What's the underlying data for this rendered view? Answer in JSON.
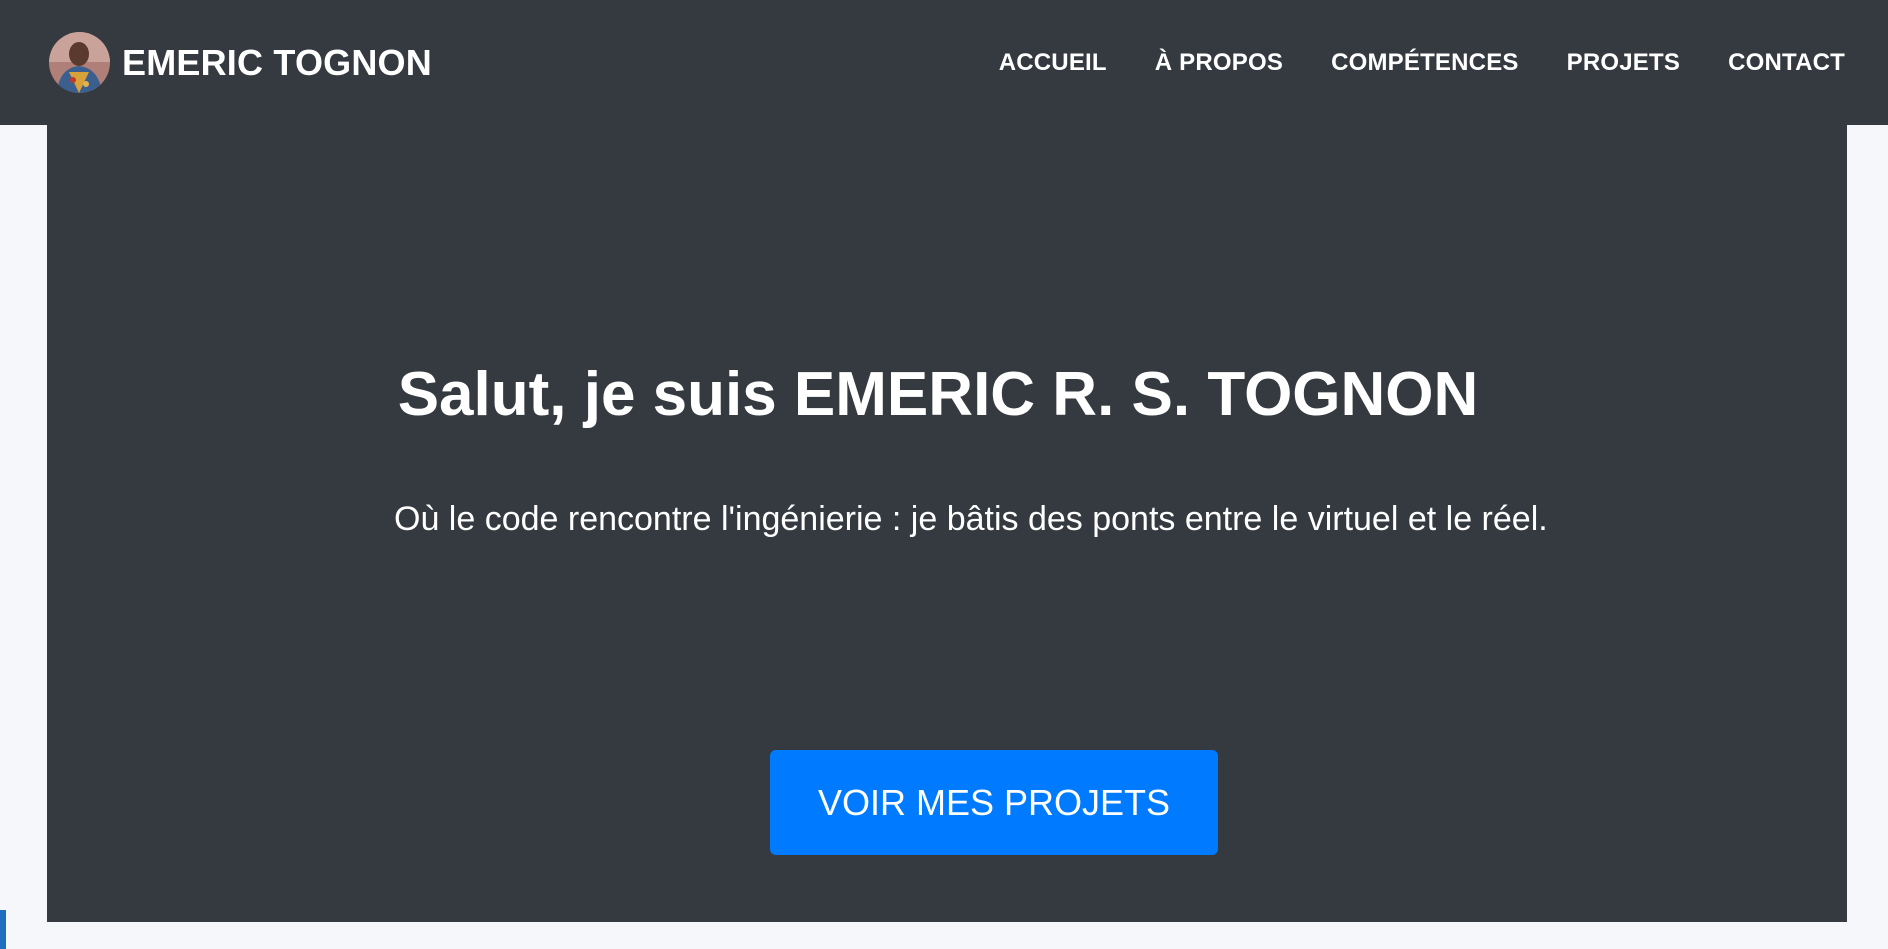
{
  "navbar": {
    "brand_name": "EMERIC TOGNON",
    "avatar_alt": "Photo de profil",
    "links": [
      {
        "label": "ACCUEIL"
      },
      {
        "label": "À PROPOS"
      },
      {
        "label": "COMPÉTENCES"
      },
      {
        "label": "PROJETS"
      },
      {
        "label": "CONTACT"
      }
    ]
  },
  "hero": {
    "title": "Salut, je suis EMERIC R. S. TOGNON",
    "tagline": "Où le code rencontre l'ingénierie : je bâtis des ponts entre le virtuel et le réel.",
    "cta_label": "VOIR MES PROJETS"
  },
  "colors": {
    "navbar_bg": "#343a40",
    "hero_bg": "#343a40",
    "page_bg": "#f5f7fa",
    "accent": "#007bff",
    "text": "#ffffff"
  }
}
